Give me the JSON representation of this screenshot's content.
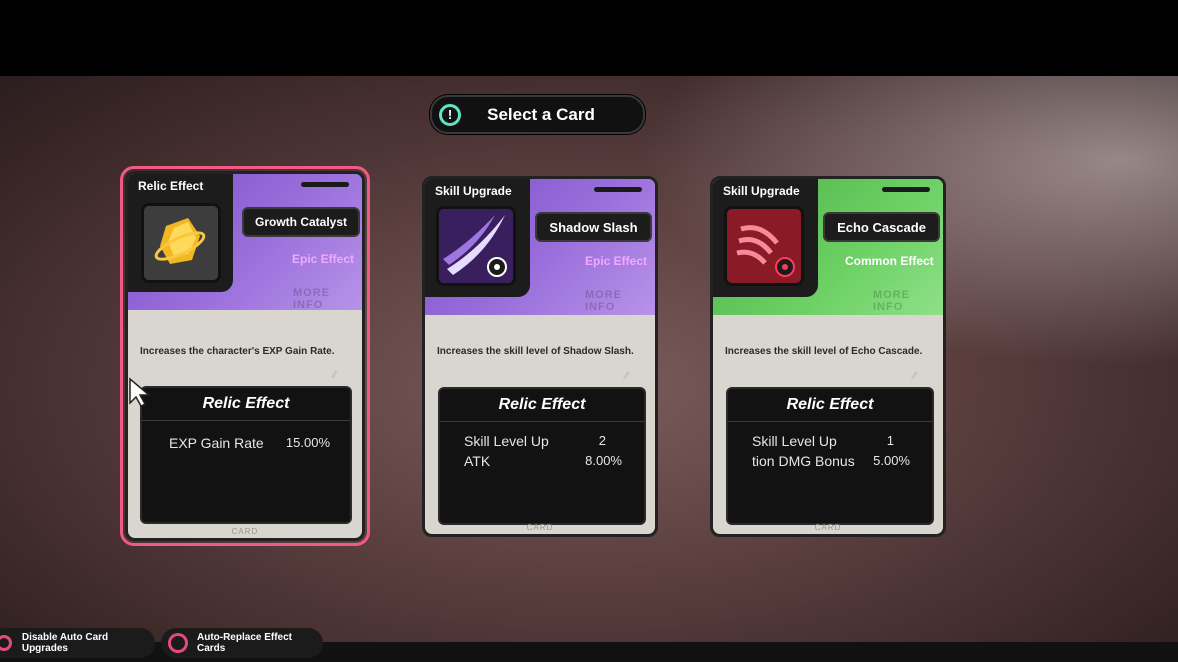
{
  "header": {
    "title": "Select a Card",
    "icon": "alert-icon",
    "accent": "#5fe3c2"
  },
  "cards": [
    {
      "type": "Relic Effect",
      "name": "Growth Catalyst",
      "rarity": "Epic Effect",
      "rarity_color": "#e8a6ff",
      "more_info": "MORE INFO",
      "description": "Increases the character's EXP Gain Rate.",
      "effect_title": "Relic Effect",
      "stats": [
        {
          "name": "EXP Gain Rate",
          "value": "15.00%"
        }
      ],
      "footer": "CARD",
      "selected": true,
      "theme": "#9a6fdc"
    },
    {
      "type": "Skill Upgrade",
      "name": "Shadow Slash",
      "rarity": "Epic Effect",
      "rarity_color": "#e8a6ff",
      "more_info": "MORE INFO",
      "description": "Increases the skill level of Shadow Slash.",
      "effect_title": "Relic Effect",
      "stats": [
        {
          "name": "Skill Level Up",
          "value": "2"
        },
        {
          "name": "ATK",
          "value": "8.00%"
        }
      ],
      "footer": "CARD",
      "selected": false,
      "theme": "#9a6fdc"
    },
    {
      "type": "Skill Upgrade",
      "name": "Echo Cascade",
      "rarity": "Common Effect",
      "rarity_color": "#ffffff",
      "more_info": "MORE INFO",
      "description": "Increases the skill level of Echo Cascade.",
      "effect_title": "Relic Effect",
      "stats": [
        {
          "name": "Skill Level Up",
          "value": "1"
        },
        {
          "name": "tion DMG Bonus",
          "value": "5.00%"
        }
      ],
      "footer": "CARD",
      "selected": false,
      "theme": "#6cd064"
    }
  ],
  "footer": {
    "disable_auto_upgrades": "Disable Auto Card Upgrades",
    "auto_replace": "Auto-Replace Effect Cards",
    "ring_color": "#e64a7d"
  }
}
